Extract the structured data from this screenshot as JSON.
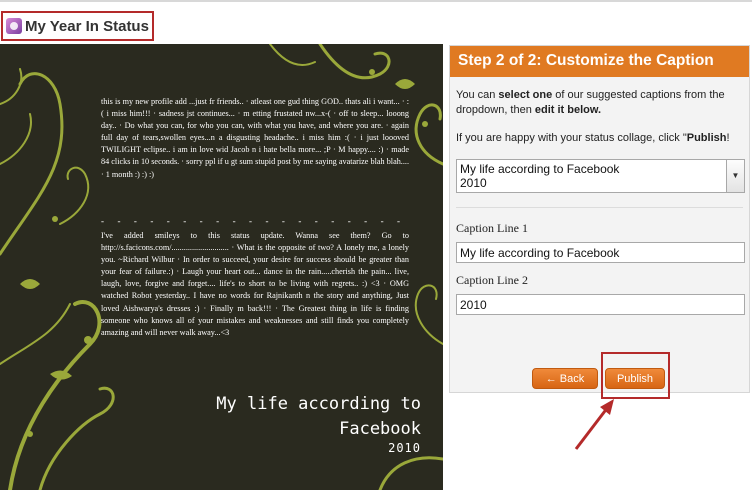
{
  "app": {
    "title": "My Year In Status"
  },
  "collage": {
    "status_paragraph_1": "this is my new profile add ...just fr friends.. · atleast one gud thing GOD.. thats ali i want... · :( i miss him!!! · sadness jst continues... · m etting frustated nw...x-( · off to sleep... looong day.. · Do what you can, for who you can, with what you have, and where you are. · again full day of tears,swollen eyes...n a disgusting headache.. i miss him :( · i just loooved TWILIGHT eclipse.. i am in love wid Jacob n i hate bella more... ;P · M happy.... :) · made 84 clicks in 10 seconds. · sorry ppl if u gt sum stupid post by me saying avatarize blah blah.... · 1 month :) :) :)",
    "divider": "- - - - - - - - - - - - - - - - - - - - - - - - - - - - - - - - - - - -",
    "status_paragraph_2": "I've added smileys to this status update. Wanna see them? Go to http://s.facicons.com/............................ · What is the opposite of two? A lonely me, a lonely you. ~Richard Wilbur · In order to succeed, your desire for success should be greater than your fear of failure.:) · Laugh your heart out... dance in the rain.....cherish the pain... live, laugh, love, forgive and forget.... life's to short to be living with regrets.. :) <3 · OMG watched Robot yesterday.. I have no words for Rajnikanth n the story and anything, Just loved Aishwarya's dresses :) · Finally m back!!! · The Greatest thing in life is finding someone who knows all of your mistakes and weaknesses and still finds you completely amazing and will never walk away...<3",
    "caption_line_1": "My life according to",
    "caption_line_2": "Facebook",
    "caption_year": "2010"
  },
  "panel": {
    "title": "Step 2 of 2: Customize the Caption",
    "instr_1": "You can ",
    "instr_1_bold": "select one",
    "instr_1_rest": " of our suggested captions from the dropdown, then ",
    "instr_1_bold2": "edit it below.",
    "instr_2": "If you are happy with your status collage, click \"",
    "instr_2_bold": "Publish",
    "instr_2_end": "!",
    "dropdown_line_1": "My life according to Facebook",
    "dropdown_line_2": "2010",
    "caption_line_1_label": "Caption Line 1",
    "caption_line_1_value": "My life according to Facebook",
    "caption_line_2_label": "Caption Line 2",
    "caption_line_2_value": "2010"
  },
  "buttons": {
    "back": "← Back",
    "publish": "Publish"
  },
  "colors": {
    "accent": "#e07a22",
    "highlight": "#b42a2a",
    "collage_bg": "#2a2a1f",
    "swirl": "#9aa83a"
  }
}
